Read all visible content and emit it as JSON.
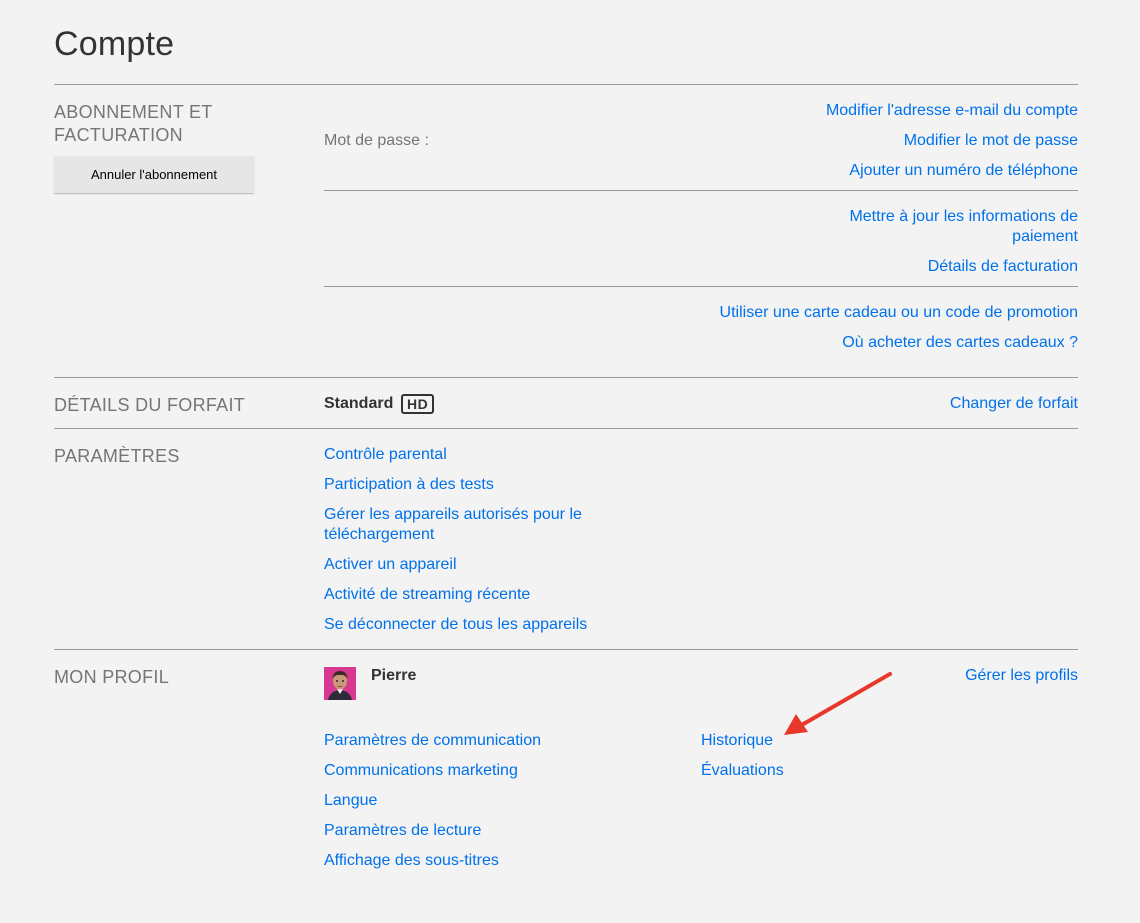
{
  "page": {
    "title": "Compte"
  },
  "membership": {
    "title": "ABONNEMENT ET FACTURATION",
    "cancel_label": "Annuler l'abonnement",
    "password_label": "Mot de passe :",
    "links_account": [
      "Modifier l'adresse e-mail du compte",
      "Modifier le mot de passe",
      "Ajouter un numéro de téléphone"
    ],
    "links_billing": [
      "Mettre à jour les informations de paiement",
      "Détails de facturation"
    ],
    "links_gift": [
      "Utiliser une carte cadeau ou un code de promotion",
      "Où acheter des cartes cadeaux ?"
    ]
  },
  "plan": {
    "title": "DÉTAILS DU FORFAIT",
    "name": "Standard",
    "badge": "HD",
    "change_label": "Changer de forfait"
  },
  "settings": {
    "title": "PARAMÈTRES",
    "links": [
      "Contrôle parental",
      "Participation à des tests",
      "Gérer les appareils autorisés pour le téléchargement",
      "Activer un appareil",
      "Activité de streaming récente",
      "Se déconnecter de tous les appareils"
    ]
  },
  "profile": {
    "title": "MON PROFIL",
    "name": "Pierre",
    "manage_label": "Gérer les profils",
    "links_left": [
      "Paramètres de communication",
      "Communications marketing",
      "Langue",
      "Paramètres de lecture",
      "Affichage des sous-titres"
    ],
    "links_right": [
      "Historique",
      "Évaluations"
    ]
  },
  "colors": {
    "link": "#0071eb",
    "background": "#f3f3f3",
    "annotation_arrow": "#e8372b",
    "avatar_bg": "#d8388f"
  },
  "icons": {
    "annotation": "red-arrow-icon",
    "avatar": "profile-avatar-icon"
  }
}
